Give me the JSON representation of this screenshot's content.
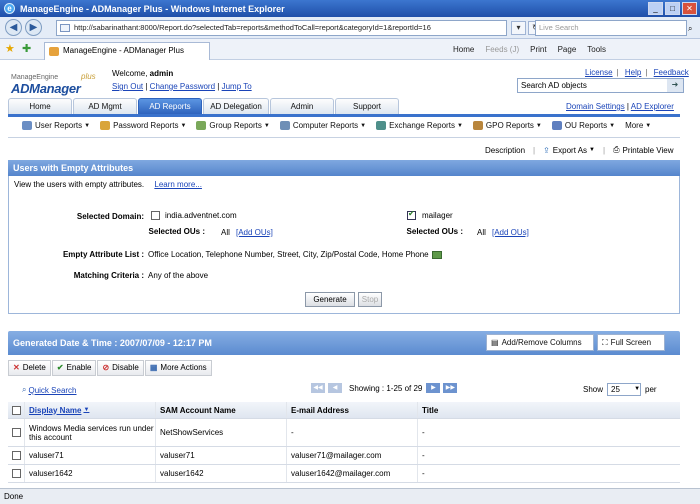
{
  "window": {
    "title": "ManageEngine - ADManager Plus - Windows Internet Explorer",
    "url": "http://sabarinathant:8000/Report.do?selectedTab=reports&methodToCall=report&categoryId=1&reportId=16",
    "live_search_placeholder": "Live Search",
    "tab_title": "ManageEngine - ADManager Plus",
    "tools": [
      "Home",
      "Feeds (J)",
      "Print",
      "Page",
      "Tools"
    ],
    "status": "Done"
  },
  "header": {
    "welcome_label": "Welcome,",
    "user": "admin",
    "links": [
      "Sign Out",
      "Change Password",
      "Jump To"
    ],
    "top_links": [
      "License",
      "Help",
      "Feedback"
    ],
    "search_placeholder": "Search AD objects",
    "logo_small": "ManageEngine",
    "logo_main": "ADManager",
    "logo_plus": "plus"
  },
  "main_tabs": [
    {
      "label": "Home",
      "active": false
    },
    {
      "label": "AD Mgmt",
      "active": false
    },
    {
      "label": "AD Reports",
      "active": true
    },
    {
      "label": "AD Delegation",
      "active": false
    },
    {
      "label": "Admin",
      "active": false
    },
    {
      "label": "Support",
      "active": false
    }
  ],
  "right_tab_links": [
    "Domain Settings",
    "AD Explorer"
  ],
  "submenu": [
    {
      "label": "User Reports",
      "icon": "user-icon",
      "color": "#6b8ec4"
    },
    {
      "label": "Password Reports",
      "icon": "key-icon",
      "color": "#d9a53a"
    },
    {
      "label": "Group Reports",
      "icon": "group-icon",
      "color": "#7aa85a"
    },
    {
      "label": "Computer Reports",
      "icon": "computer-icon",
      "color": "#6f8fb6"
    },
    {
      "label": "Exchange Reports",
      "icon": "exchange-icon",
      "color": "#4e8f8a"
    },
    {
      "label": "GPO Reports",
      "icon": "gpo-icon",
      "color": "#b9863d"
    },
    {
      "label": "OU Reports",
      "icon": "ou-icon",
      "color": "#5f7fbf"
    },
    {
      "label": "More",
      "icon": "",
      "color": ""
    }
  ],
  "actions": [
    "Description",
    "Export As",
    "Printable View"
  ],
  "report": {
    "title": "Users with Empty Attributes",
    "description": "View the users with empty attributes.",
    "learn_more": "Learn more...",
    "selected_domain_label": "Selected Domain:",
    "domains": [
      {
        "name": "india.adventnet.com",
        "checked": false,
        "ous_label": "Selected OUs :",
        "ous_value": "All",
        "add_ous": "[Add OUs]"
      },
      {
        "name": "mailager",
        "checked": true,
        "ous_label": "Selected OUs :",
        "ous_value": "All",
        "add_ous": "[Add OUs]"
      }
    ],
    "empty_attr_label": "Empty Attribute List :",
    "empty_attr_value": "Office Location, Telephone Number, Street, City, Zip/Postal Code, Home Phone",
    "matching_label": "Matching Criteria :",
    "matching_value": "Any of the above",
    "generate_label": "Generate",
    "stop_label": "Stop"
  },
  "results": {
    "generated": "Generated Date & Time : 2007/07/09 - 12:17 PM",
    "add_remove_columns": "Add/Remove Columns",
    "full_screen": "Full Screen",
    "toolbar": [
      "Delete",
      "Enable",
      "Disable",
      "More Actions"
    ],
    "quick_search": "Quick Search",
    "showing": "Showing : 1-25 of 29",
    "show_label": "Show",
    "per_page": "25",
    "per_label": "per",
    "columns": [
      "Display Name",
      "SAM Account Name",
      "E-mail Address",
      "Title"
    ],
    "rows": [
      [
        "Windows Media services run under this account",
        "NetShowServices",
        "-",
        "-"
      ],
      [
        "valuser71",
        "valuser71",
        "valuser71@mailager.com",
        "-"
      ],
      [
        "valuser1642",
        "valuser1642",
        "valuser1642@mailager.com",
        "-"
      ]
    ]
  }
}
